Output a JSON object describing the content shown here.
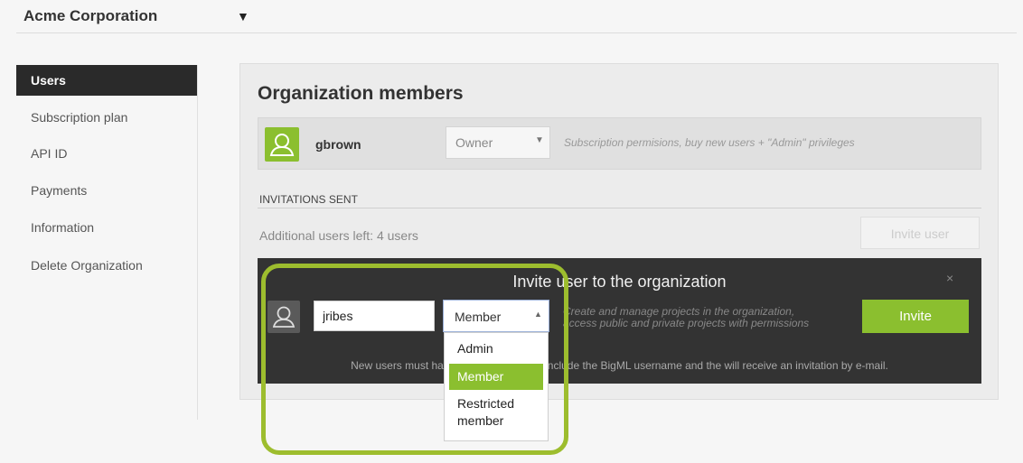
{
  "header": {
    "org_name": "Acme Corporation",
    "caret": "▼"
  },
  "sidebar": {
    "items": [
      {
        "label": "Users",
        "active": true
      },
      {
        "label": "Subscription plan"
      },
      {
        "label": "API ID"
      },
      {
        "label": "Payments"
      },
      {
        "label": "Information"
      },
      {
        "label": "Delete Organization"
      }
    ]
  },
  "main": {
    "title": "Organization members",
    "member": {
      "username": "gbrown",
      "role": "Owner",
      "role_description": "Subscription permisions, buy new users + \"Admin\" privileges"
    },
    "invitations_heading": "INVITATIONS SENT",
    "users_left": "Additional users left: 4 users",
    "invite_user_button": "Invite user"
  },
  "invite_box": {
    "title": "Invite user to the organization",
    "close": "×",
    "username_value": "jribes",
    "role_selected": "Member",
    "role_description_line1": "Create and manage projects in the organization,",
    "role_description_line2": "access public and private projects with permissions",
    "invite_button": "Invite",
    "note": "New users must have a BigML account. Include the BigML username and the will receive an invitation by e-mail.",
    "role_options": [
      "Admin",
      "Member",
      "Restricted member"
    ],
    "role_options_lines": {
      "restricted_1": "Restricted",
      "restricted_2": "member"
    }
  },
  "colors": {
    "accent": "#8bbf2f",
    "dark_box": "#333333",
    "highlight": "#9dbd2e"
  },
  "icons": {
    "member_avatar": "user-icon",
    "invite_avatar": "user-icon",
    "caret": "chevron-down-icon"
  }
}
